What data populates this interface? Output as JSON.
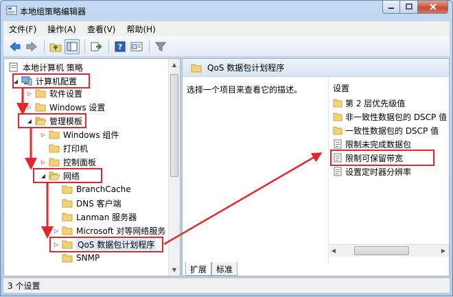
{
  "window": {
    "title": "本地组策略编辑器"
  },
  "menu": [
    "文件(F)",
    "操作(A)",
    "查看(V)",
    "帮助(H)"
  ],
  "toolbar_icons": [
    "back-icon",
    "forward-icon",
    "up-folder-icon",
    "show-tree-icon",
    "export-icon",
    "help-icon",
    "properties-icon",
    "filter-icon"
  ],
  "tree": {
    "root": "本地计算机 策略",
    "computer_config": "计算机配置",
    "software_settings": "软件设置",
    "windows_settings": "Windows 设置",
    "admin_templates": "管理模板",
    "windows_components": "Windows 组件",
    "printers": "打印机",
    "control_panel": "控制面板",
    "network": "网络",
    "branchcache": "BranchCache",
    "dns_client": "DNS 客户端",
    "lanman_server": "Lanman 服务器",
    "p2p_services": "Microsoft 对等网络服务",
    "qos": "QoS 数据包计划程序",
    "snmp": "SNMP"
  },
  "right": {
    "header": "QoS 数据包计划程序",
    "description": "选择一个项目来查看它的描述。",
    "column": "设置",
    "items": [
      {
        "label": "第 2 层优先级值",
        "icon": "folder-icon"
      },
      {
        "label": "非一致性数据包的 DSCP 值",
        "icon": "folder-icon"
      },
      {
        "label": "一致性数据包的 DSCP 值",
        "icon": "folder-icon"
      },
      {
        "label": "限制未完成数据包",
        "icon": "policy-setting-icon"
      },
      {
        "label": "限制可保留带宽",
        "icon": "policy-setting-icon"
      },
      {
        "label": "设置定时器分辨率",
        "icon": "policy-setting-icon"
      }
    ],
    "tabs": [
      "扩展",
      "标准"
    ]
  },
  "status": "3 个设置",
  "colors": {
    "highlight": "#e3262b",
    "folder": "#f3d27a"
  }
}
